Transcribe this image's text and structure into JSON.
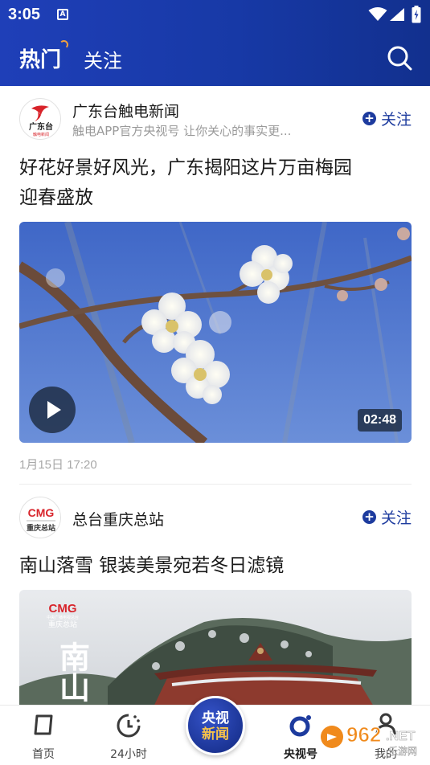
{
  "status_bar": {
    "time": "3:05",
    "notification_glyph": "A"
  },
  "header": {
    "tabs": [
      {
        "label": "热门"
      },
      {
        "label": "关注"
      }
    ],
    "search_icon": "search-icon"
  },
  "posts": [
    {
      "author": {
        "name": "广东台触电新闻",
        "desc": "触电APP官方央视号 让你关心的事实更...",
        "avatar_text": "广东台",
        "avatar_sub": "触电新闻"
      },
      "follow_label": "关注",
      "title_line1": "好花好景好风光，广东揭阳这片万亩梅园",
      "title_line2": "迎春盛放",
      "duration": "02:48",
      "time": "1月15日 17:20"
    },
    {
      "author": {
        "name": "总台重庆总站",
        "avatar_text": "CMG",
        "avatar_sub": "重庆总站"
      },
      "follow_label": "关注",
      "title": "南山落雪 银装美景宛若冬日滤镜",
      "cover_brand": "CMG",
      "cover_sub": "中央广播电视总台",
      "cover_sub2": "重庆总站",
      "cover_vertical": "南山"
    }
  ],
  "bottom_nav": {
    "items": [
      {
        "label": "首页",
        "icon": "home-icon"
      },
      {
        "label": "24小时",
        "icon": "clock-icon"
      },
      {
        "label": "央视号",
        "icon": "ring-icon"
      },
      {
        "label": "我的",
        "icon": "profile-icon"
      }
    ],
    "center_line1": "央视",
    "center_line2": "新闻"
  },
  "watermark": {
    "text": "962",
    "suffix": ".NET",
    "sub": "乐游网"
  },
  "colors": {
    "brand_blue": "#1d3b9e",
    "header_start": "#1f3fb8",
    "header_end": "#12308e",
    "accent_gold": "#f5c24a"
  }
}
